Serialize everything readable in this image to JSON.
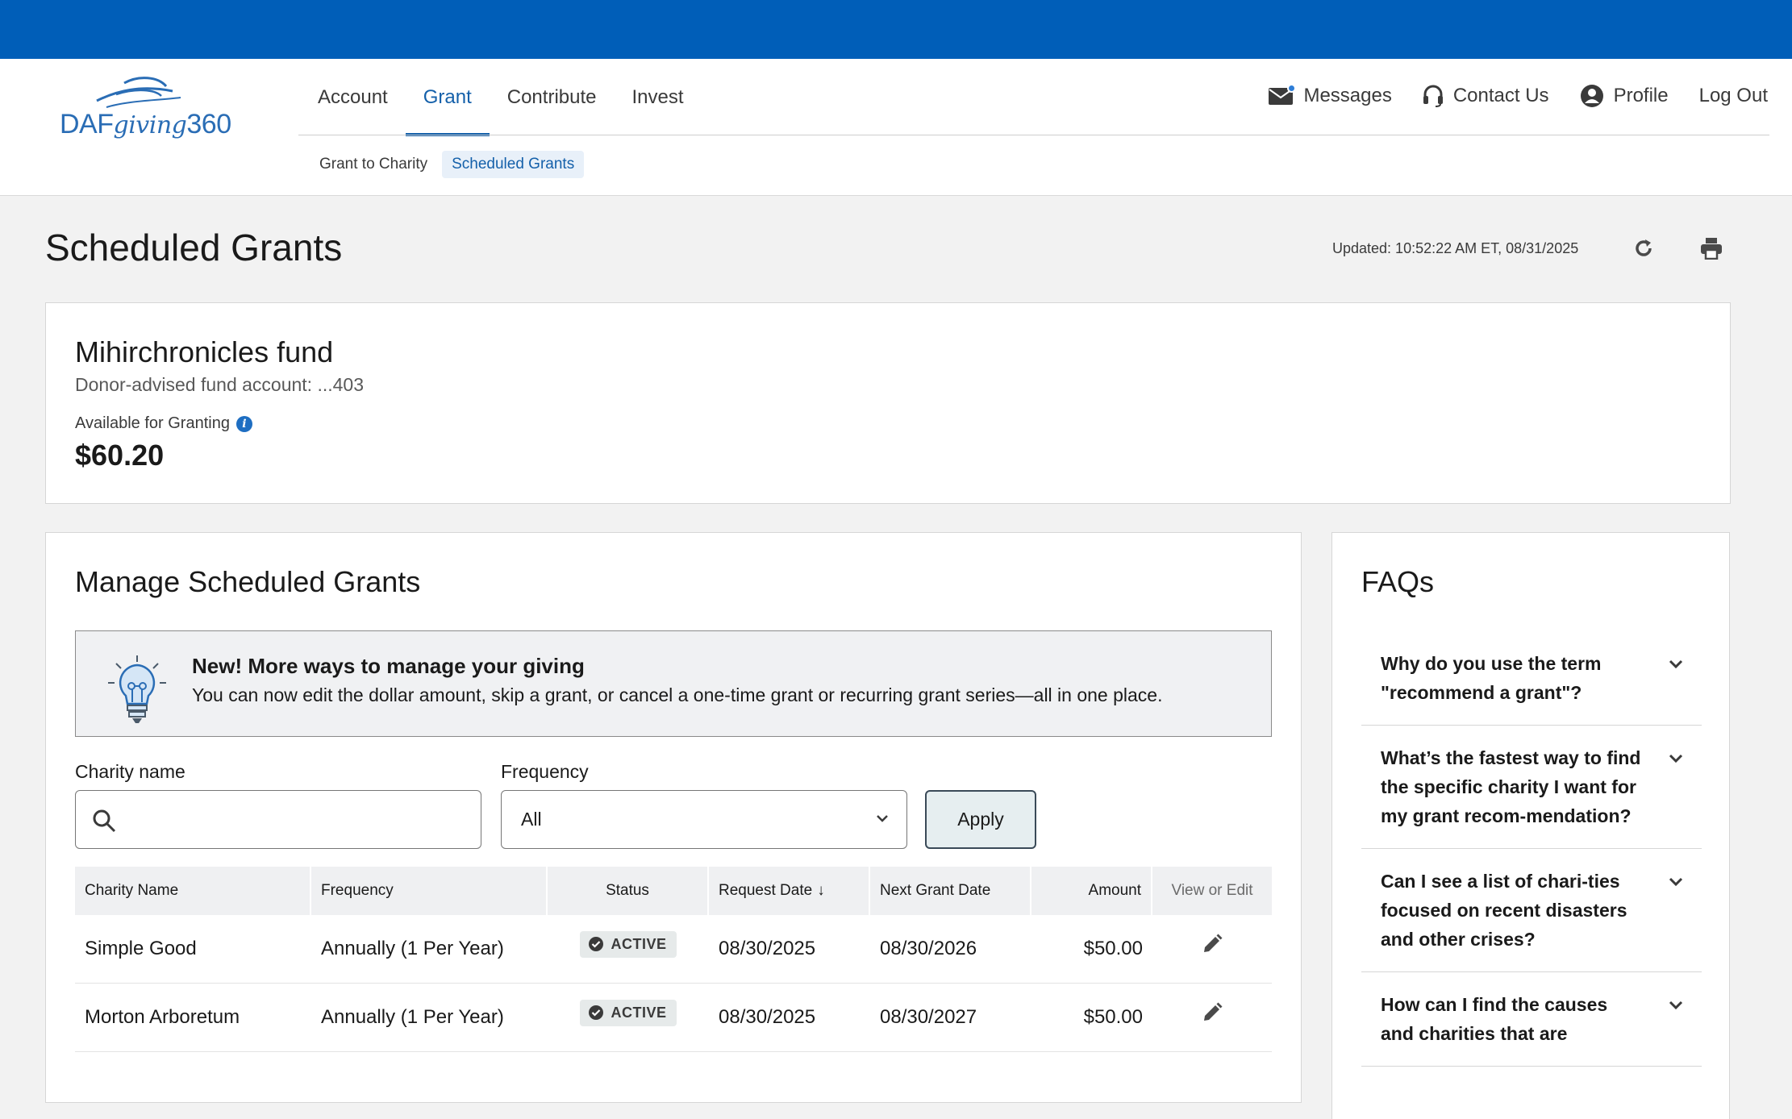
{
  "app": {
    "logo_prefix": "DAF",
    "logo_script": "giving",
    "logo_suffix": "360"
  },
  "nav": {
    "items": [
      {
        "label": "Account"
      },
      {
        "label": "Grant"
      },
      {
        "label": "Contribute"
      },
      {
        "label": "Invest"
      }
    ],
    "active": "Grant",
    "sub_items": [
      {
        "label": "Grant to Charity"
      },
      {
        "label": "Scheduled Grants"
      }
    ],
    "sub_active": "Scheduled Grants"
  },
  "util": {
    "messages": "Messages",
    "contact": "Contact Us",
    "profile": "Profile",
    "logout": "Log Out",
    "messages_icon": "envelope-icon",
    "contact_icon": "headset-icon",
    "profile_icon": "user-circle-icon"
  },
  "page": {
    "title": "Scheduled Grants",
    "updated": "Updated: 10:52:22 AM ET, 08/31/2025"
  },
  "fund": {
    "name": "Mihirchronicles fund",
    "account": "Donor-advised fund account: ...403",
    "available_label": "Available for Granting",
    "available_amount": "$60.20"
  },
  "manage": {
    "title": "Manage Scheduled Grants",
    "promo_heading": "New! More ways to manage your giving",
    "promo_body": "You can now edit the dollar amount, skip a grant, or cancel a one-time grant or recurring grant series—all in one place.",
    "charity_label": "Charity name",
    "charity_value": "",
    "frequency_label": "Frequency",
    "frequency_value": "All",
    "apply_label": "Apply"
  },
  "table": {
    "headers": {
      "charity": "Charity Name",
      "frequency": "Frequency",
      "status": "Status",
      "request_date": "Request Date",
      "next_date": "Next Grant Date",
      "amount": "Amount",
      "view_edit": "View or Edit"
    },
    "sort_indicator": "↓",
    "rows": [
      {
        "charity": "Simple Good",
        "frequency": "Annually (1 Per Year)",
        "status": "ACTIVE",
        "request_date": "08/30/2025",
        "next_date": "08/30/2026",
        "amount": "$50.00"
      },
      {
        "charity": "Morton Arboretum",
        "frequency": "Annually (1 Per Year)",
        "status": "ACTIVE",
        "request_date": "08/30/2025",
        "next_date": "08/30/2027",
        "amount": "$50.00"
      }
    ]
  },
  "faq": {
    "title": "FAQs",
    "items": [
      {
        "q": "Why do you use the term \"recommend a grant\"?"
      },
      {
        "q": "What’s the fastest way to find the specific charity I want for my grant recom-mendation?"
      },
      {
        "q": "Can I see a list of chari-ties focused on recent disasters and other crises?"
      },
      {
        "q": "How can I find the causes and charities that are"
      }
    ]
  },
  "colors": {
    "brand": "#005eb8",
    "accent": "#1460aa",
    "badge_bg": "#e6eaea"
  }
}
